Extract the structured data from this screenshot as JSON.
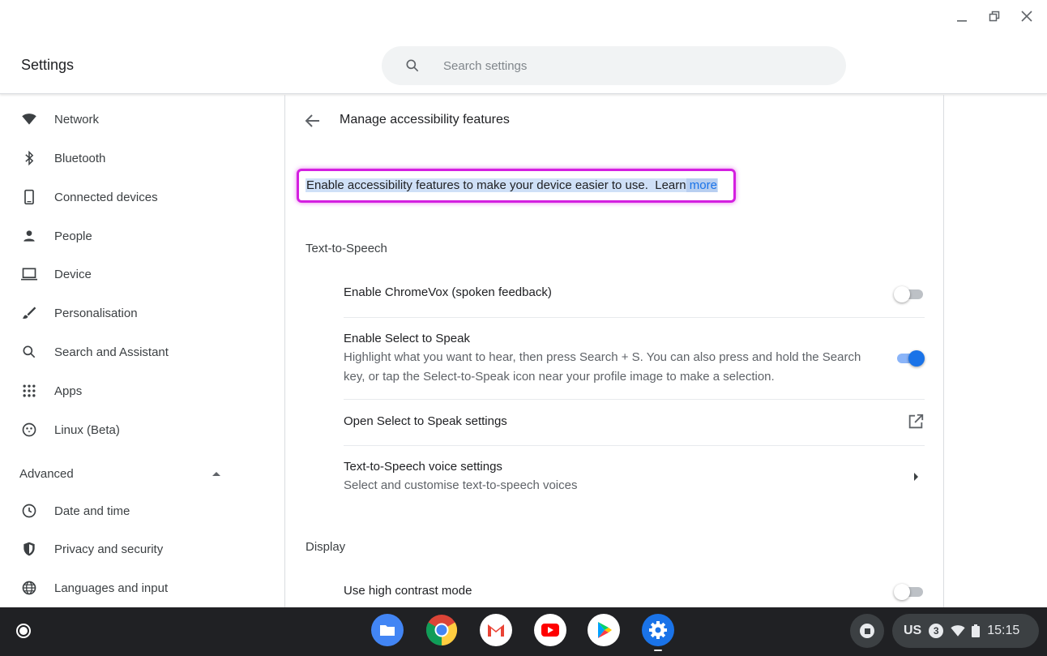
{
  "window": {
    "controls": {
      "minimize": "minimize",
      "restore": "restore",
      "close": "close"
    }
  },
  "header": {
    "app_title": "Settings",
    "search_placeholder": "Search settings"
  },
  "sidebar": {
    "items": [
      {
        "label": "Network",
        "icon": "wifi-icon"
      },
      {
        "label": "Bluetooth",
        "icon": "bluetooth-icon"
      },
      {
        "label": "Connected devices",
        "icon": "phone-icon"
      },
      {
        "label": "People",
        "icon": "person-icon"
      },
      {
        "label": "Device",
        "icon": "laptop-icon"
      },
      {
        "label": "Personalisation",
        "icon": "brush-icon"
      },
      {
        "label": "Search and Assistant",
        "icon": "search-icon"
      },
      {
        "label": "Apps",
        "icon": "apps-grid-icon"
      },
      {
        "label": "Linux (Beta)",
        "icon": "penguin-icon"
      }
    ],
    "advanced_label": "Advanced",
    "advanced_items": [
      {
        "label": "Date and time",
        "icon": "clock-icon"
      },
      {
        "label": "Privacy and security",
        "icon": "shield-icon"
      },
      {
        "label": "Languages and input",
        "icon": "globe-icon"
      }
    ]
  },
  "main": {
    "page_title": "Manage accessibility features",
    "description": "Enable accessibility features to make your device easier to use.",
    "learn_part1": "Learn",
    "learn_part2": "more",
    "sections": [
      {
        "title": "Text-to-Speech",
        "rows": [
          {
            "label": "Enable ChromeVox (spoken feedback)",
            "control": "toggle",
            "on": false
          },
          {
            "label": "Enable Select to Speak",
            "sublabel_line1": "Highlight what you want to hear, then press Search + S. You can also press and hold the Search",
            "sublabel_line2": "key, or tap the Select-to-Speak icon near your profile image to make a selection.",
            "control": "toggle",
            "on": true
          },
          {
            "label": "Open Select to Speak settings",
            "control": "external-link"
          },
          {
            "label": "Text-to-Speech voice settings",
            "sublabel": "Select and customise text-to-speech voices",
            "control": "chevron"
          }
        ]
      },
      {
        "title": "Display",
        "rows": [
          {
            "label": "Use high contrast mode",
            "control": "toggle",
            "on": false
          }
        ]
      }
    ]
  },
  "shelf": {
    "apps": [
      "Files",
      "Chrome",
      "Gmail",
      "YouTube",
      "Play Store",
      "Settings"
    ],
    "status": {
      "keyboard_layout": "US",
      "notification_count": "3",
      "time": "15:15"
    }
  },
  "colors": {
    "accent": "#1a73e8",
    "highlight_border": "#d41fe0",
    "selection_bg": "#cfe0f7",
    "shelf_bg": "#202124"
  }
}
